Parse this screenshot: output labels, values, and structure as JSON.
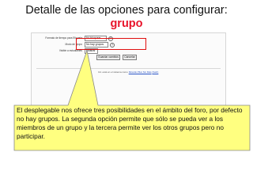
{
  "title": {
    "line1": "Detalle de las opciones para configurar:",
    "line2": "grupo"
  },
  "screenshot": {
    "rows": [
      {
        "label": "Formato de tiempo para Etiqueta",
        "value": "No bloquear"
      },
      {
        "label": "Modo de grupo",
        "value": "No hay grupos"
      },
      {
        "label": "Visible a estudiantes",
        "value": "Mostrar"
      }
    ],
    "save_button": "Guardar cambios",
    "cancel_button": "Cancelar",
    "footer_prefix": "Ud. está en el sistema como",
    "footer_user": "Ricardo Pilar Sin Más",
    "footer_suffix": "(Salir)",
    "help_glyph": "?"
  },
  "callout": {
    "text": "El desplegable nos ofrece tres posibilidades en el ámbito del foro, por defecto no hay grupos. La segunda opción permite que sólo se pueda ver a los miembros de un grupo y la tercera permite ver los otros grupos pero no participar.",
    "fill": "#ffff80",
    "border": "#888888"
  },
  "colors": {
    "accent": "#e8132a",
    "highlight_border": "#e01010"
  }
}
